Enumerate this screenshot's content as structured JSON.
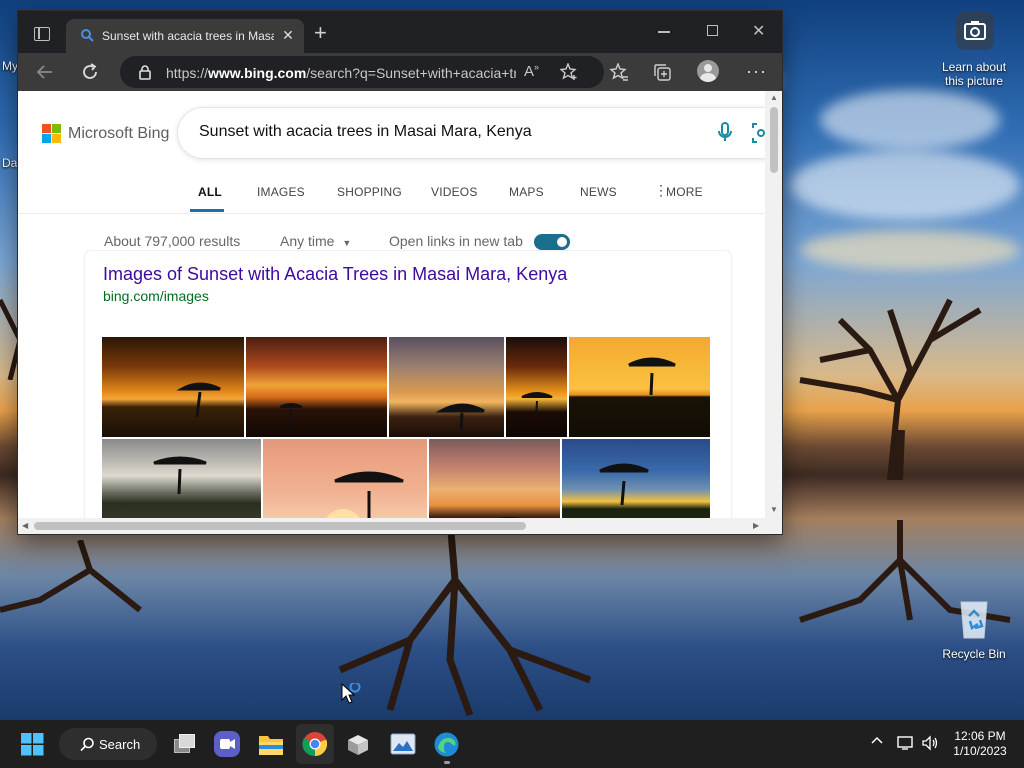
{
  "browser": {
    "tab_title": "Sunset with acacia trees in Masai Mara, Kenya - Search",
    "url_prefix": "https://",
    "url_domain": "www.bing.com",
    "url_path": "/search?q=Sunset+with+acacia+trees+in+Masai+Mara"
  },
  "bing": {
    "logo_text": "Microsoft Bing",
    "query": "Sunset with acacia trees in Masai Mara, Kenya",
    "scopes": [
      "ALL",
      "IMAGES",
      "SHOPPING",
      "VIDEOS",
      "MAPS",
      "NEWS",
      "MORE"
    ],
    "results_count": "About 797,000 results",
    "time_filter": "Any time",
    "open_links_label": "Open links in new tab",
    "open_links_on": true,
    "result": {
      "title": "Images of Sunset with Acacia Trees in Masai Mara, Kenya",
      "url": "bing.com/images"
    }
  },
  "desktop": {
    "spotlight_label_1": "Learn about",
    "spotlight_label_2": "this picture",
    "recycle_bin_label": "Recycle Bin",
    "partial_label_1": "My",
    "partial_label_2": "Da"
  },
  "taskbar": {
    "search_label": "Search",
    "time": "12:06 PM",
    "date": "1/10/2023"
  },
  "colors": {
    "bing_link": "#4007a2",
    "bing_url": "#006d21",
    "toggle": "#1a6e8e",
    "taskbar": "#1f1f1f"
  }
}
